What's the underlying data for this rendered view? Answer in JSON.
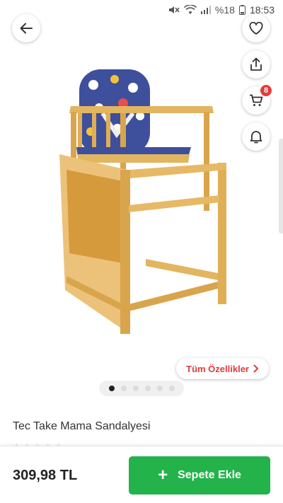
{
  "status_bar": {
    "battery_text": "%18",
    "time": "18:53"
  },
  "product": {
    "title": "Tec Take Mama Sandalyesi",
    "image_count": 6,
    "active_image_index": 0
  },
  "header": {
    "cart_count": "8"
  },
  "features_link": {
    "label": "Tüm Özellikler"
  },
  "bottom_bar": {
    "price": "309,98 TL",
    "add_to_cart_label": "Sepete Ekle"
  },
  "colors": {
    "accent_red": "#e43b3b",
    "button_green": "#24b24b"
  },
  "icons": [
    "back-arrow-icon",
    "heart-icon",
    "share-icon",
    "cart-icon",
    "bell-icon",
    "chevron-right-icon",
    "plus-icon"
  ]
}
